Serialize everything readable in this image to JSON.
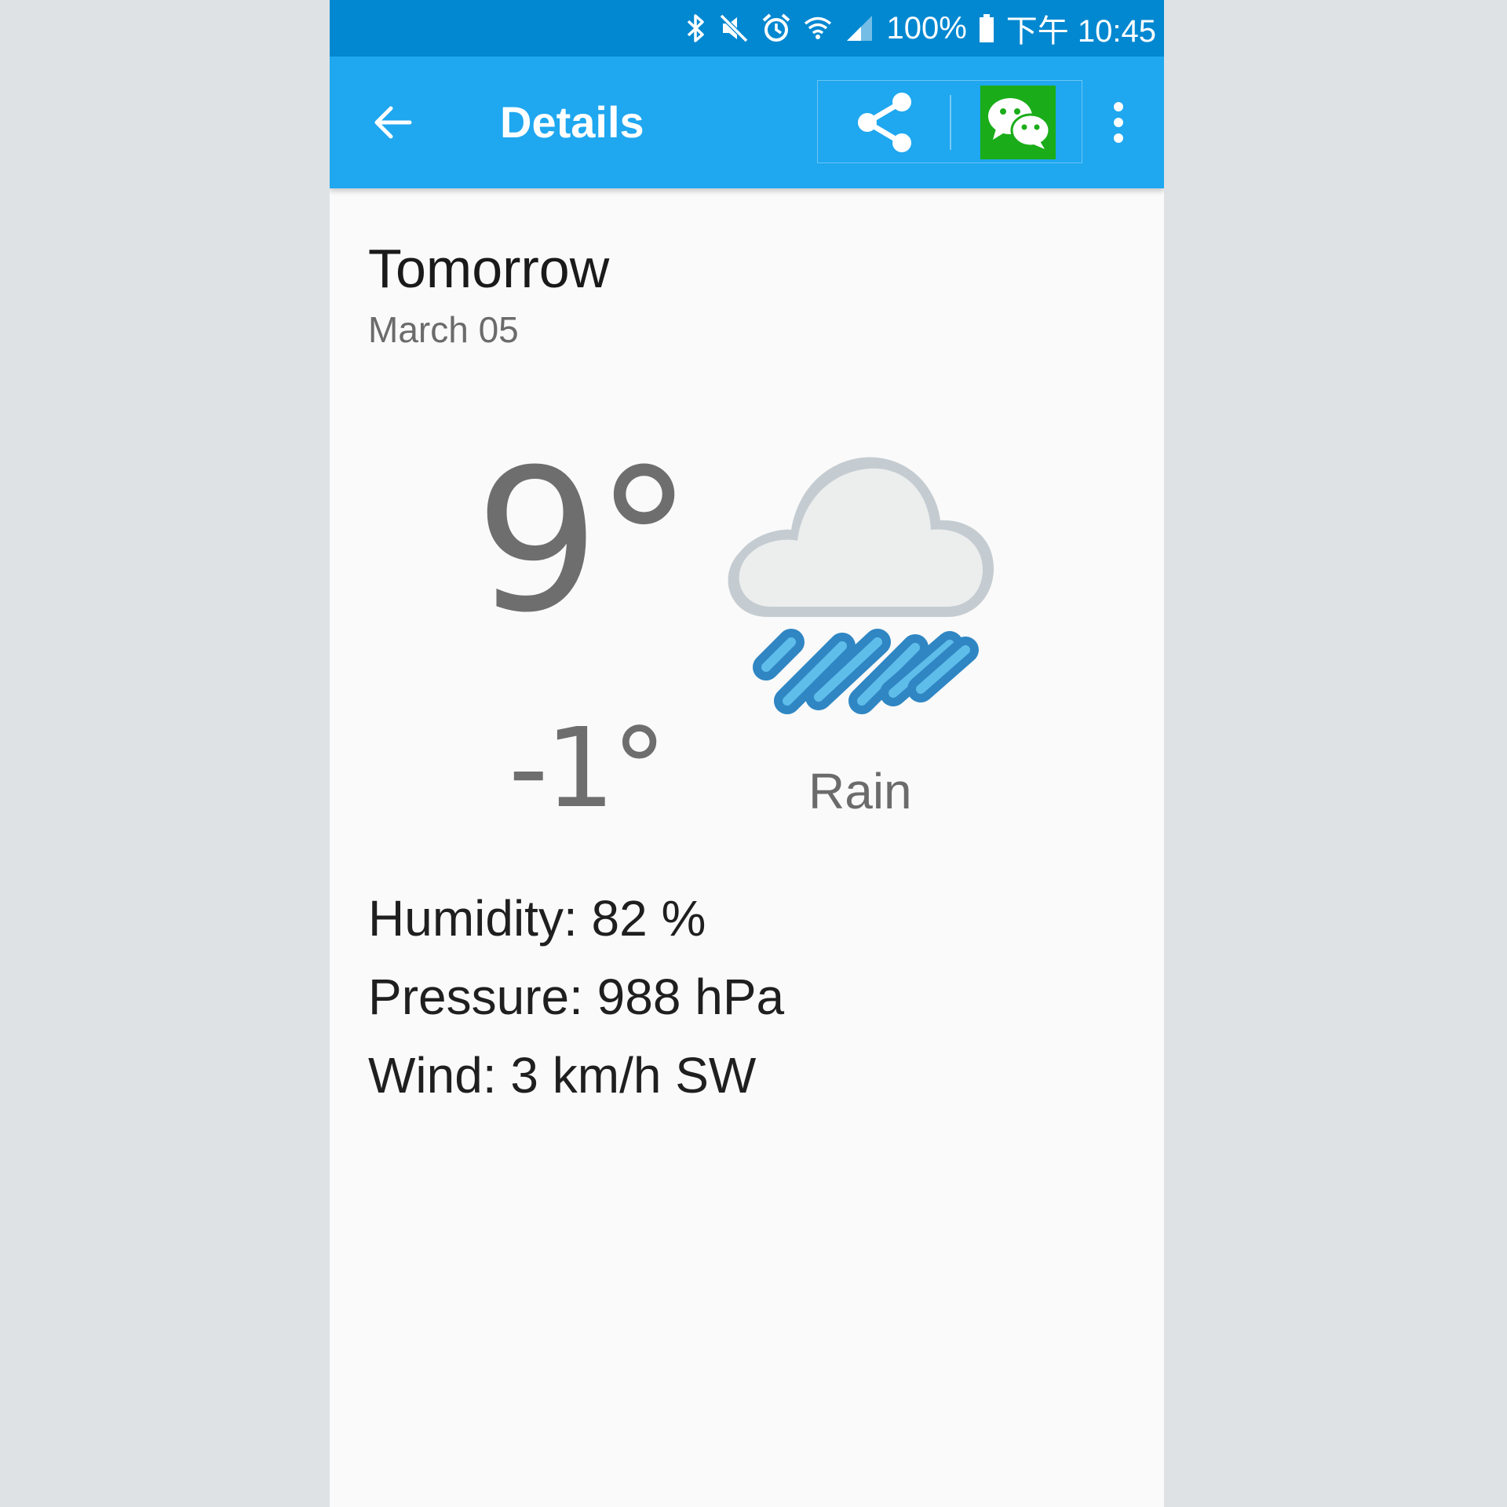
{
  "status_bar": {
    "battery": "100%",
    "time": "下午 10:45",
    "icons": [
      "bluetooth-icon",
      "mute-icon",
      "alarm-icon",
      "wifi-icon",
      "signal-icon",
      "battery-icon"
    ],
    "color": "#0288d1"
  },
  "app_bar": {
    "title": "Details",
    "back_icon": "arrow-back-icon",
    "share_icon": "share-icon",
    "wechat_icon": "wechat-icon",
    "more_icon": "more-vert-icon",
    "color": "#1fa7f0",
    "wechat_color": "#1aad19"
  },
  "forecast": {
    "day": "Tomorrow",
    "date": "March 05",
    "high": "9°",
    "low": "-1°",
    "condition": "Rain",
    "icon": "rain-cloud-icon",
    "humidity": "Humidity: 82 %",
    "pressure": "Pressure: 988 hPa",
    "wind": "Wind: 3 km/h SW"
  }
}
